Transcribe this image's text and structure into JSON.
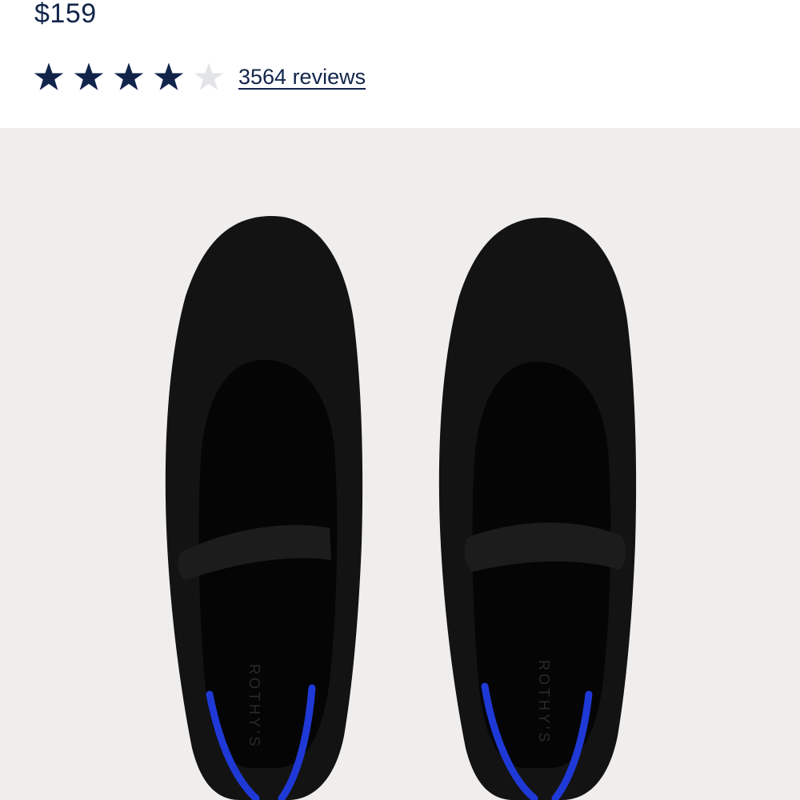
{
  "product": {
    "price": "$159",
    "rating": {
      "value": 4,
      "max": 5
    },
    "reviews_label": "3564 reviews",
    "insole_brand": "ROTHY'S"
  },
  "colors": {
    "text": "#12244a",
    "star_filled": "#12244a",
    "star_empty": "#e3e4e7",
    "image_background": "#efeeec",
    "shoe": "#131313",
    "accent_stripe": "#1f39d6"
  }
}
